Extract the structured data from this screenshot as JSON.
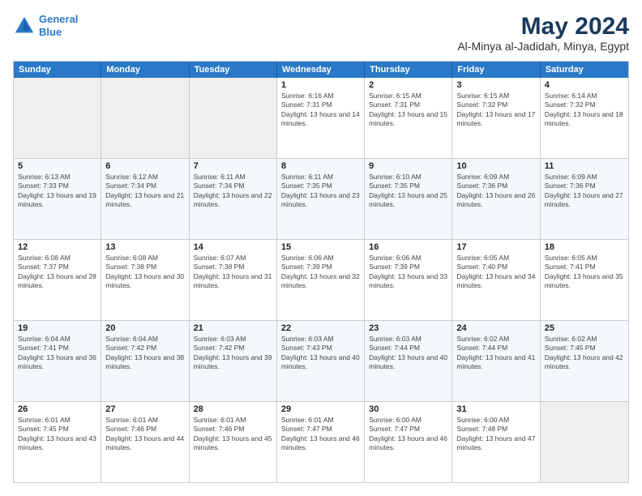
{
  "header": {
    "logo_line1": "General",
    "logo_line2": "Blue",
    "month": "May 2024",
    "location": "Al-Minya al-Jadidah, Minya, Egypt"
  },
  "weekdays": [
    "Sunday",
    "Monday",
    "Tuesday",
    "Wednesday",
    "Thursday",
    "Friday",
    "Saturday"
  ],
  "rows": [
    [
      {
        "day": "",
        "info": ""
      },
      {
        "day": "",
        "info": ""
      },
      {
        "day": "",
        "info": ""
      },
      {
        "day": "1",
        "info": "Sunrise: 6:16 AM\nSunset: 7:31 PM\nDaylight: 13 hours and 14 minutes."
      },
      {
        "day": "2",
        "info": "Sunrise: 6:15 AM\nSunset: 7:31 PM\nDaylight: 13 hours and 15 minutes."
      },
      {
        "day": "3",
        "info": "Sunrise: 6:15 AM\nSunset: 7:32 PM\nDaylight: 13 hours and 17 minutes."
      },
      {
        "day": "4",
        "info": "Sunrise: 6:14 AM\nSunset: 7:32 PM\nDaylight: 13 hours and 18 minutes."
      }
    ],
    [
      {
        "day": "5",
        "info": "Sunrise: 6:13 AM\nSunset: 7:33 PM\nDaylight: 13 hours and 19 minutes."
      },
      {
        "day": "6",
        "info": "Sunrise: 6:12 AM\nSunset: 7:34 PM\nDaylight: 13 hours and 21 minutes."
      },
      {
        "day": "7",
        "info": "Sunrise: 6:11 AM\nSunset: 7:34 PM\nDaylight: 13 hours and 22 minutes."
      },
      {
        "day": "8",
        "info": "Sunrise: 6:11 AM\nSunset: 7:35 PM\nDaylight: 13 hours and 23 minutes."
      },
      {
        "day": "9",
        "info": "Sunrise: 6:10 AM\nSunset: 7:35 PM\nDaylight: 13 hours and 25 minutes."
      },
      {
        "day": "10",
        "info": "Sunrise: 6:09 AM\nSunset: 7:36 PM\nDaylight: 13 hours and 26 minutes."
      },
      {
        "day": "11",
        "info": "Sunrise: 6:09 AM\nSunset: 7:36 PM\nDaylight: 13 hours and 27 minutes."
      }
    ],
    [
      {
        "day": "12",
        "info": "Sunrise: 6:08 AM\nSunset: 7:37 PM\nDaylight: 13 hours and 28 minutes."
      },
      {
        "day": "13",
        "info": "Sunrise: 6:08 AM\nSunset: 7:38 PM\nDaylight: 13 hours and 30 minutes."
      },
      {
        "day": "14",
        "info": "Sunrise: 6:07 AM\nSunset: 7:38 PM\nDaylight: 13 hours and 31 minutes."
      },
      {
        "day": "15",
        "info": "Sunrise: 6:06 AM\nSunset: 7:39 PM\nDaylight: 13 hours and 32 minutes."
      },
      {
        "day": "16",
        "info": "Sunrise: 6:06 AM\nSunset: 7:39 PM\nDaylight: 13 hours and 33 minutes."
      },
      {
        "day": "17",
        "info": "Sunrise: 6:05 AM\nSunset: 7:40 PM\nDaylight: 13 hours and 34 minutes."
      },
      {
        "day": "18",
        "info": "Sunrise: 6:05 AM\nSunset: 7:41 PM\nDaylight: 13 hours and 35 minutes."
      }
    ],
    [
      {
        "day": "19",
        "info": "Sunrise: 6:04 AM\nSunset: 7:41 PM\nDaylight: 13 hours and 36 minutes."
      },
      {
        "day": "20",
        "info": "Sunrise: 6:04 AM\nSunset: 7:42 PM\nDaylight: 13 hours and 38 minutes."
      },
      {
        "day": "21",
        "info": "Sunrise: 6:03 AM\nSunset: 7:42 PM\nDaylight: 13 hours and 39 minutes."
      },
      {
        "day": "22",
        "info": "Sunrise: 6:03 AM\nSunset: 7:43 PM\nDaylight: 13 hours and 40 minutes."
      },
      {
        "day": "23",
        "info": "Sunrise: 6:03 AM\nSunset: 7:44 PM\nDaylight: 13 hours and 40 minutes."
      },
      {
        "day": "24",
        "info": "Sunrise: 6:02 AM\nSunset: 7:44 PM\nDaylight: 13 hours and 41 minutes."
      },
      {
        "day": "25",
        "info": "Sunrise: 6:02 AM\nSunset: 7:45 PM\nDaylight: 13 hours and 42 minutes."
      }
    ],
    [
      {
        "day": "26",
        "info": "Sunrise: 6:01 AM\nSunset: 7:45 PM\nDaylight: 13 hours and 43 minutes."
      },
      {
        "day": "27",
        "info": "Sunrise: 6:01 AM\nSunset: 7:46 PM\nDaylight: 13 hours and 44 minutes."
      },
      {
        "day": "28",
        "info": "Sunrise: 6:01 AM\nSunset: 7:46 PM\nDaylight: 13 hours and 45 minutes."
      },
      {
        "day": "29",
        "info": "Sunrise: 6:01 AM\nSunset: 7:47 PM\nDaylight: 13 hours and 46 minutes."
      },
      {
        "day": "30",
        "info": "Sunrise: 6:00 AM\nSunset: 7:47 PM\nDaylight: 13 hours and 46 minutes."
      },
      {
        "day": "31",
        "info": "Sunrise: 6:00 AM\nSunset: 7:48 PM\nDaylight: 13 hours and 47 minutes."
      },
      {
        "day": "",
        "info": ""
      }
    ]
  ]
}
